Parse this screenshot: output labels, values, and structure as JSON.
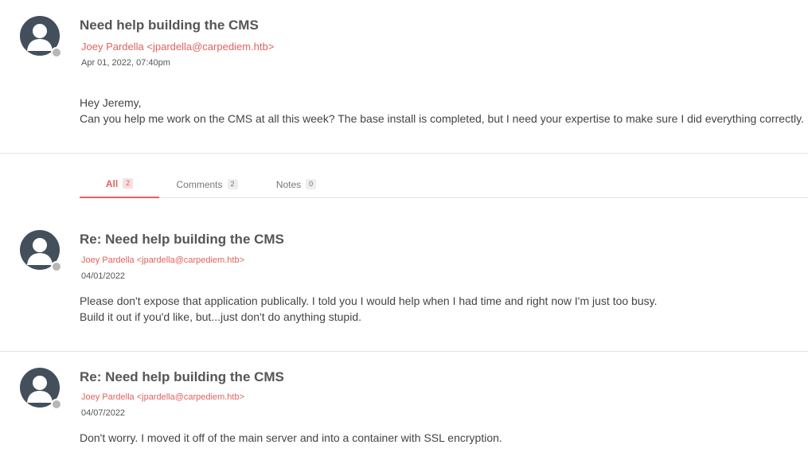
{
  "thread": {
    "title": "Need help building the CMS",
    "author": "Joey Pardella <jpardella@carpediem.htb>",
    "date": "Apr 01, 2022, 07:40pm",
    "body": [
      "Hey Jeremy,",
      "Can you help me work on the CMS at all this week? The base install is completed, but I need your expertise to make sure I did everything correctly."
    ]
  },
  "tabs": [
    {
      "label": "All",
      "count": "2",
      "active": true
    },
    {
      "label": "Comments",
      "count": "2",
      "active": false
    },
    {
      "label": "Notes",
      "count": "0",
      "active": false
    }
  ],
  "replies": [
    {
      "title": "Re: Need help building the CMS",
      "author": "Joey Pardella <jpardella@carpediem.htb>",
      "date": "04/01/2022",
      "body": [
        "Please don't expose that application publically. I told you I would help when I had time and right now I'm just too busy.",
        "Build it out if you'd like, but...just don't do anything stupid."
      ]
    },
    {
      "title": "Re: Need help building the CMS",
      "author": "Joey Pardella <jpardella@carpediem.htb>",
      "date": "04/07/2022",
      "body": [
        "Don't worry. I moved it off of the main server and into a container with SSL encryption."
      ]
    }
  ],
  "colors": {
    "accent": "#e0635d",
    "avatar": "#434f5b",
    "status_offline": "#b7b7b7"
  },
  "icons": {
    "avatar": "user-silhouette-icon",
    "status": "offline-status-dot"
  }
}
